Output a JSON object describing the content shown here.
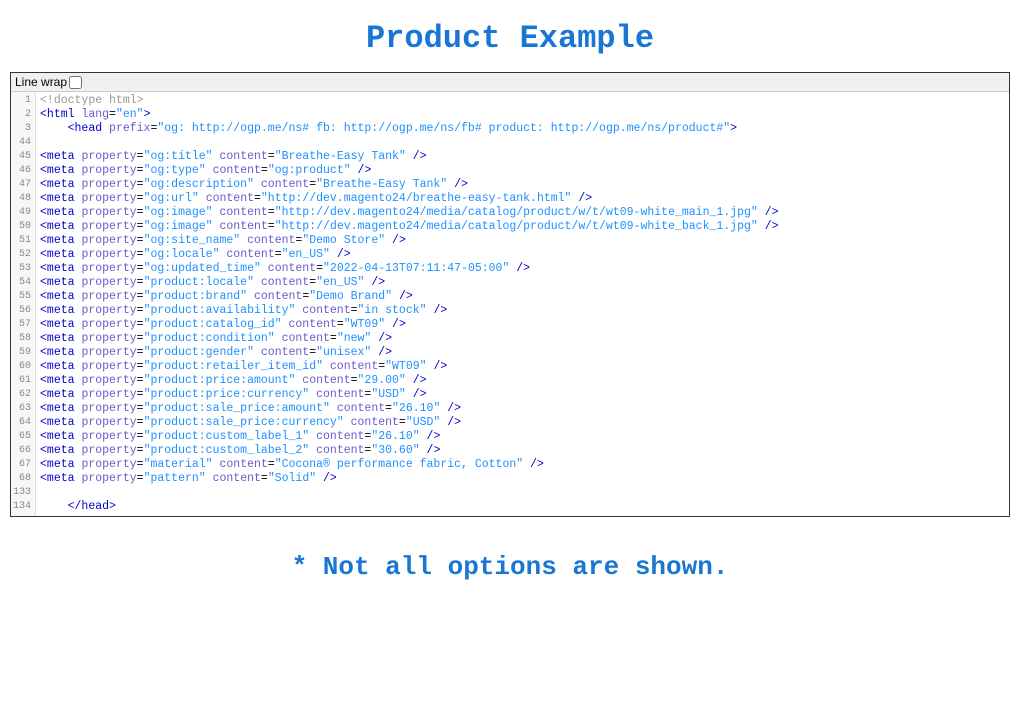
{
  "title": "Product Example",
  "footnote": "* Not all options are shown.",
  "toolbar": {
    "linewrap_label": "Line wrap"
  },
  "line_numbers": [
    "1",
    "2",
    "3",
    "44",
    "45",
    "46",
    "47",
    "48",
    "49",
    "50",
    "51",
    "52",
    "53",
    "54",
    "55",
    "56",
    "57",
    "58",
    "59",
    "60",
    "61",
    "62",
    "63",
    "64",
    "65",
    "66",
    "67",
    "68",
    "133",
    "134"
  ],
  "code_lines": [
    {
      "type": "doctype",
      "text": "<!doctype html>"
    },
    {
      "type": "tag-open",
      "tag": "html",
      "attrs": [
        {
          "name": "lang",
          "val": "en"
        }
      ],
      "indent": 0
    },
    {
      "type": "tag-open",
      "tag": "head",
      "attrs": [
        {
          "name": "prefix",
          "val": "og: http://ogp.me/ns# fb: http://ogp.me/ns/fb# product: http://ogp.me/ns/product#"
        }
      ],
      "indent": 2
    },
    {
      "type": "blank"
    },
    {
      "type": "meta",
      "property": "og:title",
      "content": "Breathe-Easy Tank"
    },
    {
      "type": "meta",
      "property": "og:type",
      "content": "og:product"
    },
    {
      "type": "meta",
      "property": "og:description",
      "content": "Breathe-Easy Tank"
    },
    {
      "type": "meta",
      "property": "og:url",
      "content": "http://dev.magento24/breathe-easy-tank.html"
    },
    {
      "type": "meta",
      "property": "og:image",
      "content": "http://dev.magento24/media/catalog/product/w/t/wt09-white_main_1.jpg"
    },
    {
      "type": "meta",
      "property": "og:image",
      "content": "http://dev.magento24/media/catalog/product/w/t/wt09-white_back_1.jpg"
    },
    {
      "type": "meta",
      "property": "og:site_name",
      "content": "Demo Store"
    },
    {
      "type": "meta",
      "property": "og:locale",
      "content": "en_US"
    },
    {
      "type": "meta",
      "property": "og:updated_time",
      "content": "2022-04-13T07:11:47-05:00"
    },
    {
      "type": "meta",
      "property": "product:locale",
      "content": "en_US"
    },
    {
      "type": "meta",
      "property": "product:brand",
      "content": "Demo Brand"
    },
    {
      "type": "meta",
      "property": "product:availability",
      "content": "in stock"
    },
    {
      "type": "meta",
      "property": "product:catalog_id",
      "content": "WT09"
    },
    {
      "type": "meta",
      "property": "product:condition",
      "content": "new"
    },
    {
      "type": "meta",
      "property": "product:gender",
      "content": "unisex"
    },
    {
      "type": "meta",
      "property": "product:retailer_item_id",
      "content": "WT09"
    },
    {
      "type": "meta",
      "property": "product:price:amount",
      "content": "29.00"
    },
    {
      "type": "meta",
      "property": "product:price:currency",
      "content": "USD"
    },
    {
      "type": "meta",
      "property": "product:sale_price:amount",
      "content": "26.10"
    },
    {
      "type": "meta",
      "property": "product:sale_price:currency",
      "content": "USD"
    },
    {
      "type": "meta",
      "property": "product:custom_label_1",
      "content": "26.10"
    },
    {
      "type": "meta",
      "property": "product:custom_label_2",
      "content": "30.60"
    },
    {
      "type": "meta",
      "property": "material",
      "content": "Cocona® performance fabric, Cotton"
    },
    {
      "type": "meta",
      "property": "pattern",
      "content": "Solid"
    },
    {
      "type": "blank"
    },
    {
      "type": "tag-close",
      "tag": "head",
      "indent": 2
    }
  ]
}
